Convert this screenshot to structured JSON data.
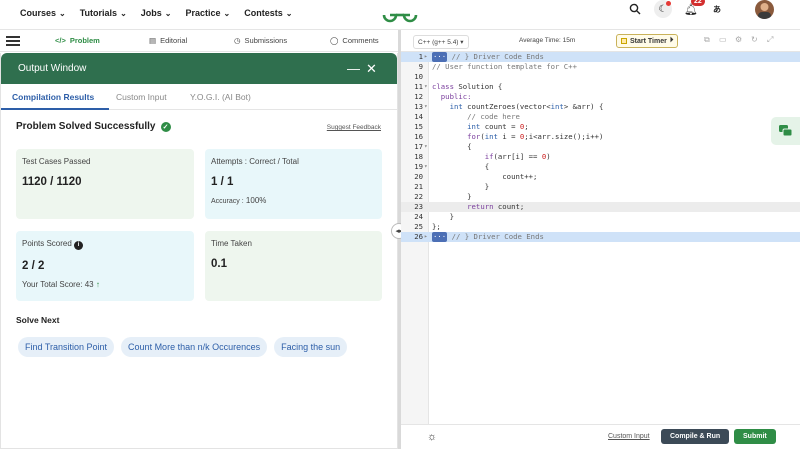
{
  "topnav": {
    "items": [
      {
        "label": "Courses"
      },
      {
        "label": "Tutorials"
      },
      {
        "label": "Jobs"
      },
      {
        "label": "Practice"
      },
      {
        "label": "Contests"
      }
    ],
    "notifications_count": "22"
  },
  "subnav": {
    "tabs": [
      {
        "label": "Problem"
      },
      {
        "label": "Editorial"
      },
      {
        "label": "Submissions"
      },
      {
        "label": "Comments"
      }
    ]
  },
  "output_window": {
    "title": "Output Window",
    "tabs": [
      {
        "label": "Compilation Results"
      },
      {
        "label": "Custom Input"
      },
      {
        "label": "Y.O.G.I. (AI Bot)"
      }
    ],
    "status": "Problem Solved Successfully",
    "suggest_feedback": "Suggest Feedback",
    "cards": {
      "test_cases": {
        "label": "Test Cases Passed",
        "value": "1120 / 1120"
      },
      "attempts": {
        "label": "Attempts : Correct / Total",
        "value": "1 / 1",
        "accuracy_label": "Accuracy :",
        "accuracy_value": "100%"
      },
      "points": {
        "label": "Points Scored",
        "value": "2 / 2",
        "total_label": "Your Total Score:",
        "total_value": "43"
      },
      "time": {
        "label": "Time Taken",
        "value": "0.1"
      }
    },
    "solve_next_title": "Solve Next",
    "solve_next": [
      {
        "label": "Find Transition Point"
      },
      {
        "label": "Count More than n/k Occurences"
      },
      {
        "label": "Facing the sun"
      }
    ]
  },
  "editor": {
    "language": "C++ (g++ 5.4)",
    "average_time": "Average Time: 15m",
    "timer_label": "Start Timer",
    "lines": [
      {
        "n": "1",
        "fold": "▸"
      },
      {
        "n": "9"
      },
      {
        "n": "10"
      },
      {
        "n": "11",
        "fold": "▾"
      },
      {
        "n": "12"
      },
      {
        "n": "13",
        "fold": "▾"
      },
      {
        "n": "14"
      },
      {
        "n": "15"
      },
      {
        "n": "16"
      },
      {
        "n": "17",
        "fold": "▾"
      },
      {
        "n": "18"
      },
      {
        "n": "19",
        "fold": "▾"
      },
      {
        "n": "20"
      },
      {
        "n": "21"
      },
      {
        "n": "22"
      },
      {
        "n": "23"
      },
      {
        "n": "24"
      },
      {
        "n": "25"
      },
      {
        "n": "26",
        "fold": "▸"
      }
    ],
    "code": {
      "l1": "// } Driver Code Ends",
      "l9": "// User function template for C++",
      "l11a": "class",
      "l11b": " Solution {",
      "l12": "  public:",
      "l13a": "    int",
      "l13b": " countZeroes(vector<",
      "l13c": "int",
      "l13d": "> &arr) {",
      "l14": "        // code here",
      "l15a": "        int",
      "l15b": " count = ",
      "l15c": "0",
      "l15d": ";",
      "l16a": "        for",
      "l16b": "(",
      "l16c": "int",
      "l16d": " i = ",
      "l16e": "0",
      "l16f": ";i<arr.size();i++)",
      "l17": "        {",
      "l18a": "            if",
      "l18b": "(arr[i] == ",
      "l18c": "0",
      "l18d": ")",
      "l19": "            {",
      "l20": "                count++;",
      "l21": "            }",
      "l22": "        }",
      "l23a": "        return",
      "l23b": " count;",
      "l24": "    }",
      "l25": "};",
      "l26": "// } Driver Code Ends"
    },
    "custom_input": "Custom Input",
    "compile_run": "Compile & Run",
    "submit": "Submit"
  }
}
